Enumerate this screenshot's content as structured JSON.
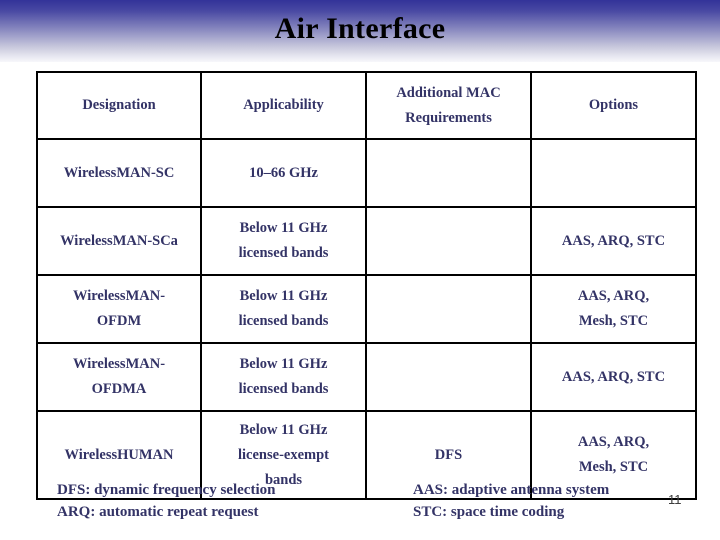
{
  "slide": {
    "title": "Air Interface",
    "page_number": "11",
    "accent_band_color": "#333399",
    "text_color": "#333366",
    "border_color": "#000000"
  },
  "table": {
    "headers": [
      "Designation",
      "Applicability",
      [
        "Additional MAC",
        "Requirements"
      ],
      "Options"
    ],
    "rows": [
      {
        "designation": [
          "WirelessMAN-SC"
        ],
        "applicability": [
          "10–66 GHz"
        ],
        "additional_mac_requirements": [
          ""
        ],
        "options": [
          ""
        ]
      },
      {
        "designation": [
          "WirelessMAN-SCa"
        ],
        "applicability": [
          "Below 11 GHz",
          "licensed bands"
        ],
        "additional_mac_requirements": [
          ""
        ],
        "options": [
          "AAS, ARQ, STC"
        ]
      },
      {
        "designation": [
          "WirelessMAN-",
          "OFDM"
        ],
        "applicability": [
          "Below 11 GHz",
          "licensed bands"
        ],
        "additional_mac_requirements": [
          ""
        ],
        "options": [
          "AAS, ARQ,",
          "Mesh, STC"
        ]
      },
      {
        "designation": [
          "WirelessMAN-",
          "OFDMA"
        ],
        "applicability": [
          "Below 11 GHz",
          "licensed bands"
        ],
        "additional_mac_requirements": [
          ""
        ],
        "options": [
          "AAS, ARQ, STC"
        ]
      },
      {
        "designation": [
          "WirelessHUMAN"
        ],
        "applicability": [
          "Below 11 GHz",
          "license-exempt",
          "bands"
        ],
        "additional_mac_requirements": [
          "DFS"
        ],
        "options": [
          "AAS, ARQ,",
          "Mesh, STC"
        ]
      }
    ]
  },
  "legend": {
    "left": [
      "DFS: dynamic frequency selection",
      "ARQ: automatic repeat request"
    ],
    "right": [
      "AAS: adaptive antenna system",
      "STC: space time coding"
    ]
  }
}
